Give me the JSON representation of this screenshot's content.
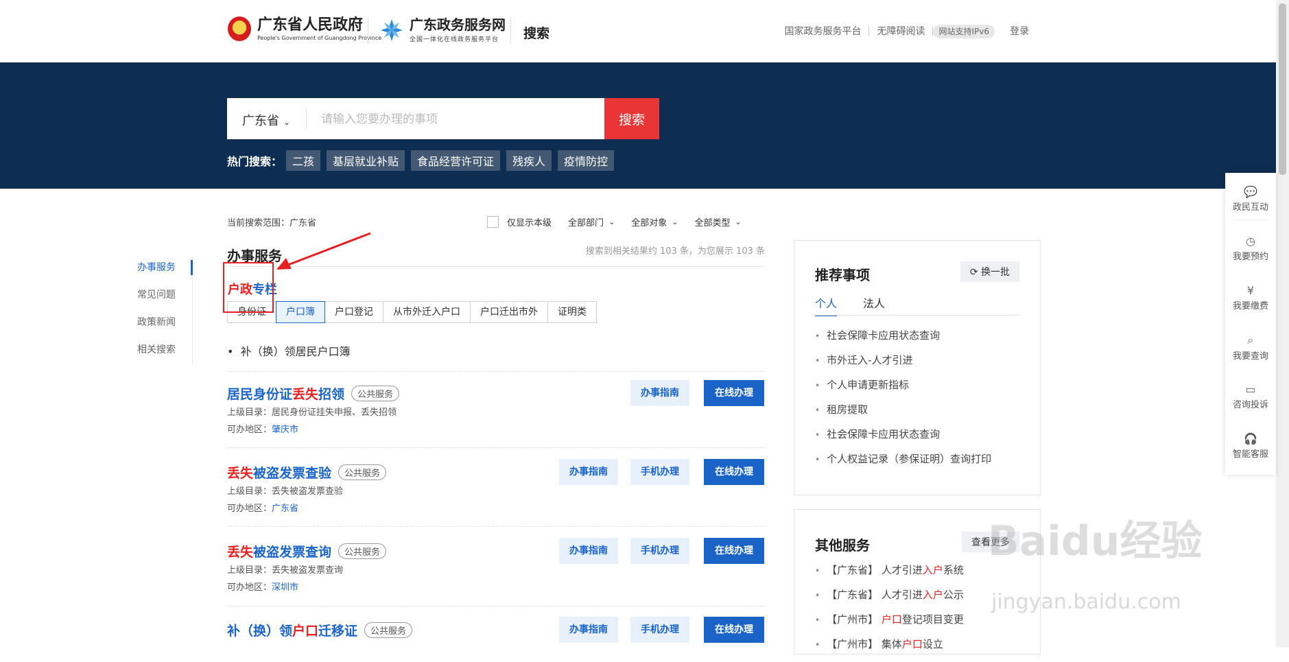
{
  "header": {
    "gov_name": "广东省人民政府",
    "gov_name_en": "People's Government of Guangdong Province",
    "site_name": "广东政务服务网",
    "site_sub": "全国一体化在线政务服务平台",
    "search_tag": "搜索",
    "nav": [
      "国家政务服务平台",
      "无障碍阅读",
      "网站支持IPv6",
      "登录"
    ]
  },
  "search": {
    "province": "广东省",
    "placeholder": "请输入您要办理的事项",
    "button": "搜索",
    "hot_label": "热门搜索：",
    "hot_tags": [
      "二孩",
      "基层就业补贴",
      "食品经营许可证",
      "残疾人",
      "疫情防控"
    ]
  },
  "left_nav": [
    "办事服务",
    "常见问题",
    "政策新闻",
    "相关搜索"
  ],
  "filters": {
    "scope": "当前搜索范围：广东省",
    "only_level": "仅显示本级",
    "dept": "全部部门",
    "target": "全部对象",
    "type": "全部类型"
  },
  "main": {
    "title": "办事服务",
    "count": "搜索到相关结果约 103 条，为您展示 103 条",
    "section_red": "户政",
    "section_blue": "专栏",
    "tabs": [
      "身份证",
      "户口簿",
      "户口登记",
      "从市外迁入户口",
      "户口迁出市外",
      "证明类"
    ],
    "bullet": "补（换）领居民户口簿",
    "results": [
      {
        "t1": "居民身份证",
        "t2": "丢失",
        "t3": "招领",
        "badge": "公共服务",
        "l1_label": "上级目录：",
        "l1": "居民身份证挂失申报、丢失招领",
        "l2_label": "可办地区：",
        "l2": "肇庆市",
        "btn_guide": "办事指南",
        "btn_online": "在线办理"
      },
      {
        "t1": "",
        "t2": "丢失",
        "t3": "被盗发票查验",
        "badge": "公共服务",
        "l1_label": "上级目录：",
        "l1": "丢失被盗发票查验",
        "l2_label": "可办地区：",
        "l2": "广东省",
        "btn_guide": "办事指南",
        "btn_mobile": "手机办理",
        "btn_online": "在线办理"
      },
      {
        "t1": "",
        "t2": "丢失",
        "t3": "被盗发票查询",
        "badge": "公共服务",
        "l1_label": "上级目录：",
        "l1": "丢失被盗发票查询",
        "l2_label": "可办地区：",
        "l2": "深圳市",
        "btn_guide": "办事指南",
        "btn_mobile": "手机办理",
        "btn_online": "在线办理"
      },
      {
        "t1": "补（换）领",
        "t2": "户口",
        "t3": "迁移证",
        "badge": "公共服务",
        "btn_guide": "办事指南",
        "btn_mobile": "手机办理",
        "btn_online": "在线办理"
      }
    ]
  },
  "recommend": {
    "title": "推荐事项",
    "refresh": "换一批",
    "tabs": [
      "个人",
      "法人"
    ],
    "items": [
      "社会保障卡应用状态查询",
      "市外迁入-人才引进",
      "个人申请更新指标",
      "租房提取",
      "社会保障卡应用状态查询",
      "个人权益记录（参保证明）查询打印"
    ]
  },
  "other": {
    "title": "其他服务",
    "more": "查看更多",
    "items": [
      {
        "a": "【广东省】 人才引进",
        "b": "入户",
        "c": "系统"
      },
      {
        "a": "【广东省】 人才引进",
        "b": "入户",
        "c": "公示"
      },
      {
        "a": "【广州市】 ",
        "b": "户口",
        "c": "登记项目变更"
      },
      {
        "a": "【广州市】 集体",
        "b": "户口",
        "c": "设立"
      }
    ]
  },
  "float_bar": [
    "政民互动",
    "我要预约",
    "我要缴费",
    "我要查询",
    "咨询投诉",
    "智能客服"
  ],
  "watermark": {
    "main": "Baidu经验",
    "sub": "jingyan.baidu.com"
  },
  "colors": {
    "banner": "#0e2d52",
    "accent": "#1a64c8",
    "red": "#e93535"
  }
}
